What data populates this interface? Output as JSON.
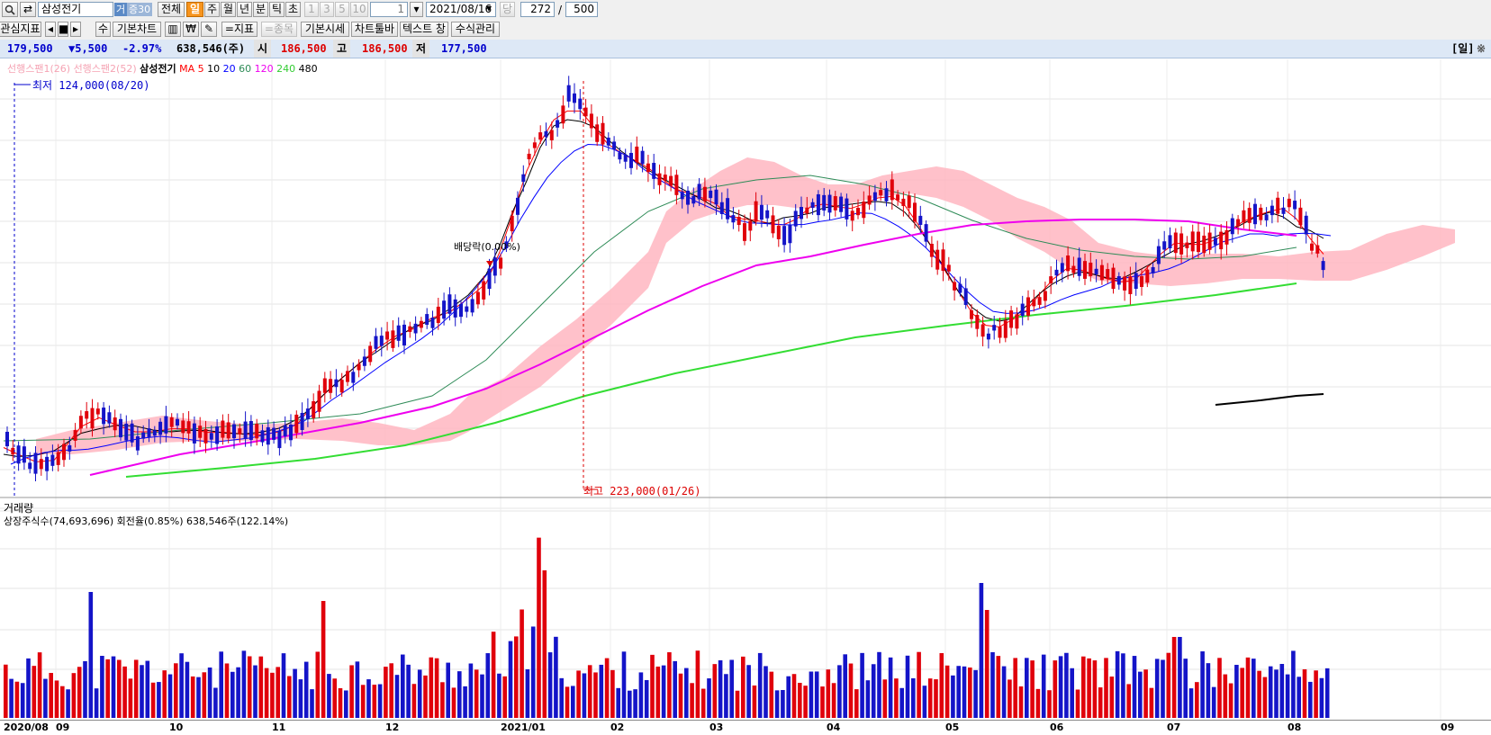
{
  "toolbar": {
    "search_value": "삼성전기",
    "trade_badge": "거",
    "trade_value": "증30",
    "all_label": "전체",
    "periods": [
      "일",
      "주",
      "월",
      "년",
      "분",
      "틱",
      "초"
    ],
    "active_period": "일",
    "intervals": [
      "1",
      "3",
      "5",
      "10"
    ],
    "interval_value": "1",
    "date_value": "2021/08/16",
    "dang_label": "당",
    "count_value": "272",
    "slash": "/",
    "total_value": "500"
  },
  "toolbar2": {
    "indicator_label": "관심지표",
    "su_label": "수",
    "basic_chart_label": "기본차트",
    "won_symbol": "₩",
    "indicator_button": "=지표",
    "item_button": "=종목",
    "basic_quote_label": "기본시세",
    "chart_toolbar_label": "차트툴바",
    "text_window_label": "텍스트 창",
    "formula_label": "수식관리"
  },
  "infobar": {
    "price": "179,500",
    "change": "▼5,500",
    "change_pct": "-2.97%",
    "volume": "638,546(주)",
    "open_label": "시",
    "open": "186,500",
    "high_label": "고",
    "high": "186,500",
    "low_label": "저",
    "low": "177,500",
    "right_label": "[일]",
    "close_icon_glyph": "※"
  },
  "legend": {
    "span1": "선행스팬1(26)",
    "span2": "선행스팬2(52)",
    "title": "삼성전기",
    "ma_label": "MA",
    "ma_periods": [
      "5",
      "10",
      "20",
      "60",
      "120",
      "240",
      "480"
    ]
  },
  "annotations": {
    "low": "최저 124,000(08/20)",
    "high": "최고 223,000(01/26)",
    "dividend": "배당락(0.00%)"
  },
  "volume_panel": {
    "title": "거래량",
    "info": "상장주식수(74,693,696) 회전율(0.85%) 638,546주(122.14%)"
  },
  "xaxis": {
    "labels": [
      "2020/08",
      "09",
      "10",
      "11",
      "12",
      "2021/01",
      "02",
      "03",
      "04",
      "05",
      "06",
      "07",
      "08",
      "09"
    ]
  },
  "colors": {
    "up": "#e0000b",
    "down": "#1414c8",
    "ma5": "#ff0000",
    "ma10": "#000000",
    "ma20": "#0000ff",
    "ma60": "#2e8b57",
    "ma120": "#ee00ee",
    "ma240": "#33dd33",
    "ma480": "#000000",
    "cloud": "#ffb6c1"
  },
  "chart_data": {
    "type": "candlestick",
    "symbol": "삼성전기",
    "price_range": [
      124000,
      223000
    ],
    "last": {
      "close": 179500,
      "open": 186500,
      "high": 186500,
      "low": 177500,
      "volume": 638546
    },
    "dates": [
      "2020/08",
      "09",
      "10",
      "11",
      "12",
      "2021/01",
      "02",
      "03",
      "04",
      "05",
      "06",
      "07",
      "08",
      "09"
    ],
    "overlays": [
      "MA5",
      "MA10",
      "MA20",
      "MA60",
      "MA120",
      "MA240",
      "MA480",
      "선행스팬1(26)",
      "선행스팬2(52)"
    ]
  }
}
